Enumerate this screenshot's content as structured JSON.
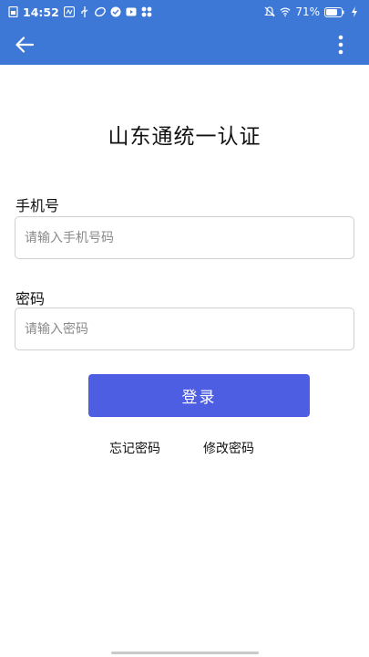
{
  "status_bar": {
    "time": "14:52",
    "battery_percent": "71%",
    "icons_left": [
      "doc-icon",
      "nfc-icon",
      "usb-icon",
      "app-icon",
      "check-icon",
      "video-icon",
      "grid-icon"
    ],
    "icons_right": [
      "mute-icon",
      "wifi-icon",
      "battery-icon",
      "charging-icon"
    ]
  },
  "app_bar": {
    "back_icon": "arrow-left-icon",
    "more_icon": "more-vertical-icon"
  },
  "title": "山东通统一认证",
  "form": {
    "phone_label": "手机号",
    "phone_placeholder": "请输入手机号码",
    "phone_value": "",
    "password_label": "密码",
    "password_placeholder": "请输入密码",
    "password_value": "",
    "login_label": "登录"
  },
  "links": {
    "forgot": "忘记密码",
    "change": "修改密码"
  },
  "colors": {
    "primary_bar": "#3d78d6",
    "button": "#4d5ee3"
  }
}
